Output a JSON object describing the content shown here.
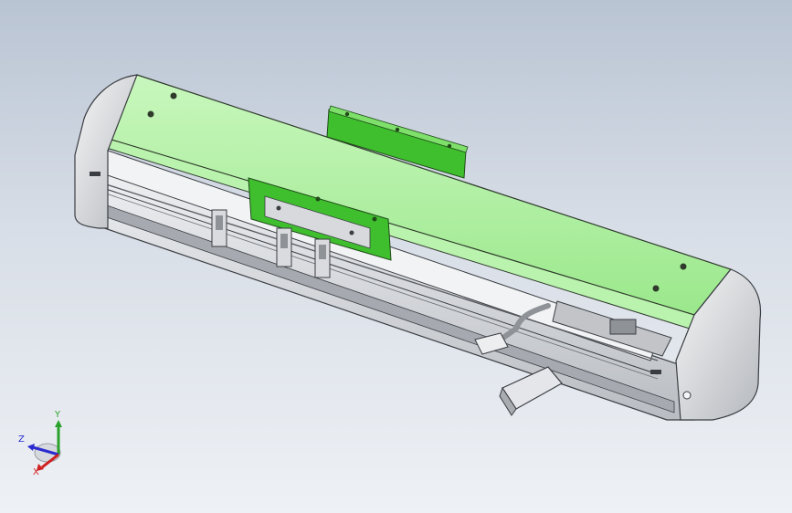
{
  "scene": {
    "model": "linear-actuator-module",
    "colors": {
      "background_top": "#b9c4d3",
      "background_bottom": "#eef1f5",
      "cover_green": "#9af08a",
      "bracket_green": "#3fbf2e",
      "housing_gray": "#d6d8dc",
      "edge_dark": "#3a3d42"
    }
  },
  "triad": {
    "y_label": "Y",
    "z_label": "Z",
    "x_label": "X",
    "y_color": "#2aa12a",
    "z_color": "#2b2bd0",
    "x_color": "#d02020"
  }
}
